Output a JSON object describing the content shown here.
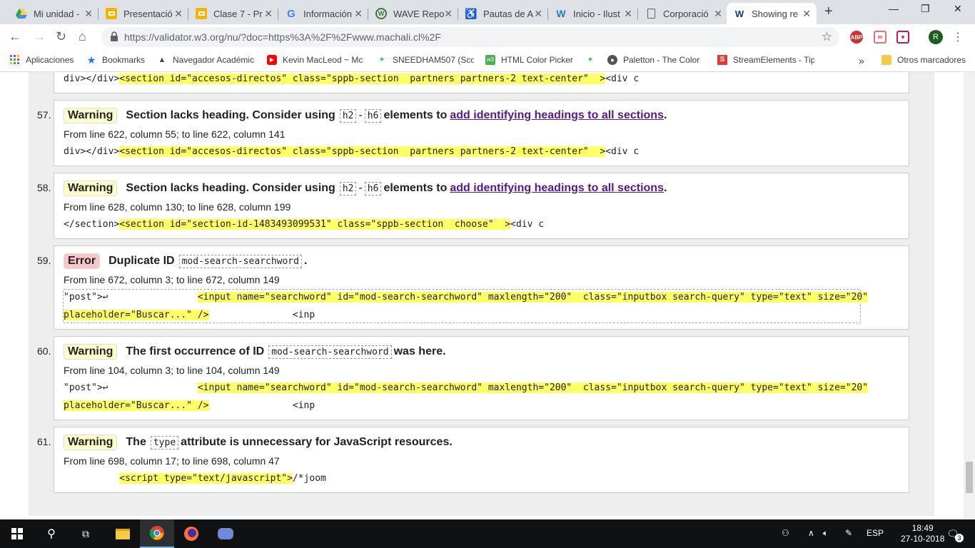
{
  "tabs": [
    {
      "title": "Mi unidad -",
      "icon": "google-drive-icon",
      "color": "#1fa463"
    },
    {
      "title": "Presentació",
      "icon": "google-slides-icon",
      "color": "#f4b400"
    },
    {
      "title": "Clase 7 - Pr",
      "icon": "google-slides-icon",
      "color": "#f4b400"
    },
    {
      "title": "Información",
      "icon": "google-icon",
      "color": "#4285f4"
    },
    {
      "title": "WAVE Repo",
      "icon": "wave-icon",
      "color": "#3b7a3b"
    },
    {
      "title": "Pautas de A",
      "icon": "accessibility-icon",
      "color": "#2962a8"
    },
    {
      "title": "Inicio - Ilust",
      "icon": "w-icon",
      "color": "#2a7ab8"
    },
    {
      "title": "Corporació",
      "icon": "document-icon",
      "color": "#5f6368"
    },
    {
      "title": "Showing re",
      "icon": "w3c-icon",
      "color": "#1a3a6e"
    }
  ],
  "url": "https://validator.w3.org/nu/?doc=https%3A%2F%2Fwww.machali.cl%2F",
  "bookmarks": [
    {
      "label": "Aplicaciones",
      "icon": "apps-icon"
    },
    {
      "label": "Bookmarks",
      "icon": "star-icon"
    },
    {
      "label": "Navegador Académic",
      "icon": "navigator-icon"
    },
    {
      "label": "Kevin MacLeod ~ Mc",
      "icon": "youtube-icon"
    },
    {
      "label": "SNEEDHAM507 (Scot",
      "icon": "leaf-icon"
    },
    {
      "label": "HTML Color Picker",
      "icon": "w3schools-icon"
    },
    {
      "label": "",
      "icon": "leaf-icon"
    },
    {
      "label": "Paletton - The Color",
      "icon": "paletton-icon"
    },
    {
      "label": "StreamElements - Tip",
      "icon": "streamelements-icon"
    }
  ],
  "bookmarks_more": "»",
  "other_bookmarks": "Otros marcadores",
  "prev_extract": "div></div><section id=\"accesos-directos\" class=\"sppb-section  partners partners-2 text-center\"  ><div c",
  "prev_extract_pre": "div></div>",
  "prev_extract_hl": "<section id=\"accesos-directos\" class=\"sppb-section  partners partners-2 text-center\"  >",
  "prev_extract_post": "<div c",
  "messages": [
    {
      "num": "57.",
      "type": "Warning",
      "pre": "Section lacks heading. Consider using",
      "code1": "h2",
      "dash": "-",
      "code2": "h6",
      "post": "elements to",
      "link": "add identifying headings to all sections",
      "end": ".",
      "loc": "From line 622, column 55; to line 622, column 141",
      "ex_pre": "div></div>",
      "ex_hl": "<section id=\"accesos-directos\" class=\"sppb-section  partners partners-2 text-center\"  >",
      "ex_post": "<div c"
    },
    {
      "num": "58.",
      "type": "Warning",
      "pre": "Section lacks heading. Consider using",
      "code1": "h2",
      "dash": "-",
      "code2": "h6",
      "post": "elements to",
      "link": "add identifying headings to all sections",
      "end": ".",
      "loc": "From line 628, column 130; to line 628, column 199",
      "ex_pre": "</section>",
      "ex_hl": "<section id=\"section-id-1483493099531\" class=\"sppb-section  choose\"  >",
      "ex_post": "<div c"
    },
    {
      "num": "59.",
      "type": "Error",
      "pre": "Duplicate ID",
      "code1": "mod-search-searchword",
      "end": ".",
      "loc": "From line 672, column 3; to line 672, column 149",
      "ex1_pre": "\"post\">↩                ",
      "ex1_hl": "<input name=\"searchword\" id=\"mod-search-searchword\" maxlength=\"200\"  class=\"inputbox search-query\" type=\"text\" size=\"20\"",
      "ex2_hl": "placeholder=\"Buscar...\" />",
      "ex2_post": "               <inp"
    },
    {
      "num": "60.",
      "type": "Warning",
      "pre": "The first occurrence of ID",
      "code1": "mod-search-searchword",
      "post": "was here.",
      "loc": "From line 104, column 3; to line 104, column 149",
      "ex1_pre": "\"post\">↩                ",
      "ex1_hl": "<input name=\"searchword\" id=\"mod-search-searchword\" maxlength=\"200\"  class=\"inputbox search-query\" type=\"text\" size=\"20\"",
      "ex2_hl": "placeholder=\"Buscar...\" />",
      "ex2_post": "               <inp"
    },
    {
      "num": "61.",
      "type": "Warning",
      "pre": "The",
      "code1": "type",
      "post": "attribute is unnecessary for JavaScript resources.",
      "loc": "From line 698, column 17; to line 698, column 47",
      "ex_pre": "          ",
      "ex_hl": "<script type=\"text/javascript\">",
      "ex_post": "/*joom"
    }
  ],
  "taskbar": {
    "lang": "ESP",
    "time": "18:49",
    "date": "27-10-2018",
    "notifications": "3"
  }
}
